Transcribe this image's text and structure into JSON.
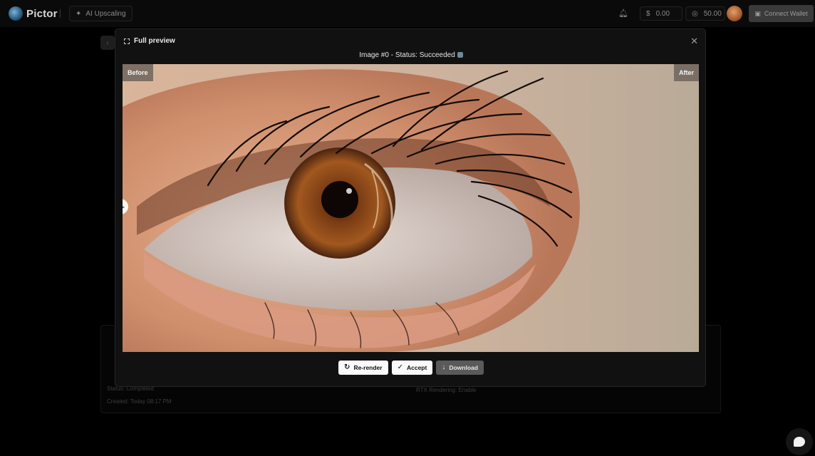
{
  "app": {
    "name": "Pictor"
  },
  "nav": {
    "current_tool": "AI Upscaling"
  },
  "header": {
    "usd_balance": "0.00",
    "usd_symbol": "$",
    "credit_balance": "50.00",
    "connect_wallet_label": "Connect Wallet"
  },
  "background": {
    "created_label": "Created: Today 08:17 PM",
    "status_label": "Status: Completed",
    "rtx_label": "RTX Rendering: Enable"
  },
  "modal": {
    "title": "Full preview",
    "image_status": "Image #0 - Status: Succeeded",
    "before_label": "Before",
    "after_label": "After"
  },
  "actions": {
    "rerender_label": "Re-render",
    "accept_label": "Accept",
    "download_label": "Download"
  },
  "icons": {
    "logo": "pictor-logo-icon",
    "tool": "sparkle-icon",
    "notifications": "bell-icon",
    "credits": "coin-icon",
    "wallet": "wallet-icon",
    "expand": "expand-icon",
    "close": "close-icon",
    "rerender": "refresh-icon",
    "accept": "check-icon",
    "download": "download-icon",
    "chat": "chat-icon"
  },
  "colors": {
    "background": "#000000",
    "modal": "#111111",
    "primary_button": "#fafafa",
    "secondary_button": "#5a5a5a"
  }
}
